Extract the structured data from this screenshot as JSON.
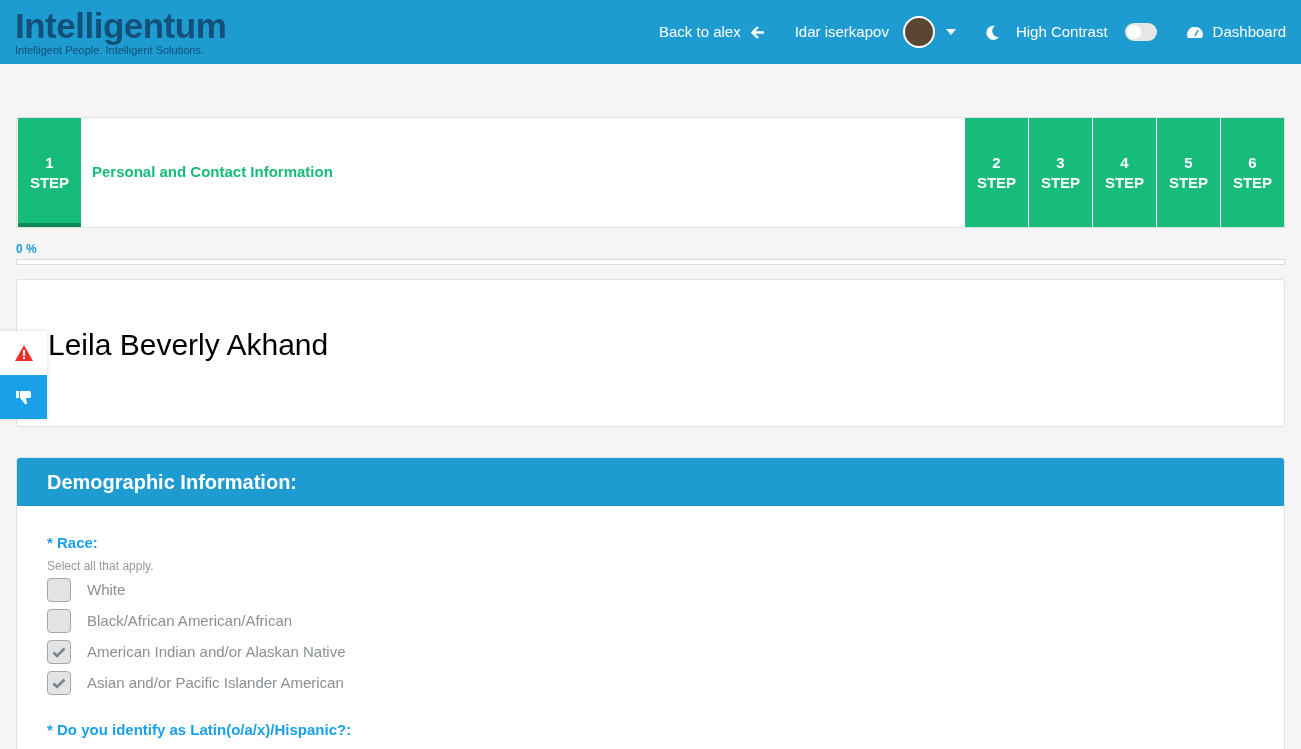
{
  "header": {
    "logo": "Intelligentum",
    "tagline": "Intelligent People. Intelligent Solutions.",
    "back_link": "Back to alex",
    "user": "Idar iserkapov",
    "high_contrast": {
      "label": "High Contrast",
      "on": false
    },
    "dashboard": "Dashboard"
  },
  "steps": [
    {
      "number": "1",
      "label": "STEP",
      "title": "Personal and Contact Information",
      "selected": true
    },
    {
      "number": "2",
      "label": "STEP",
      "selected": false
    },
    {
      "number": "3",
      "label": "STEP",
      "selected": false
    },
    {
      "number": "4",
      "label": "STEP",
      "selected": false
    },
    {
      "number": "5",
      "label": "STEP",
      "selected": false
    },
    {
      "number": "6",
      "label": "STEP",
      "selected": false
    }
  ],
  "progress": {
    "label": "0 %",
    "level": 0
  },
  "applicant_name": "Leila Beverly Akhand",
  "section": {
    "title": "Demographic Information:",
    "questions": [
      {
        "label": "* Race:",
        "hint": "Select all that apply.",
        "options": [
          {
            "label": "White",
            "checked": false
          },
          {
            "label": "Black/African American/African",
            "checked": false
          },
          {
            "label": "American Indian and/or Alaskan Native",
            "checked": true
          },
          {
            "label": "Asian and/or Pacific Islander American",
            "checked": true
          }
        ]
      },
      {
        "label": "* Do you identify as Latin(o/a/x)/Hispanic?:"
      }
    ]
  }
}
